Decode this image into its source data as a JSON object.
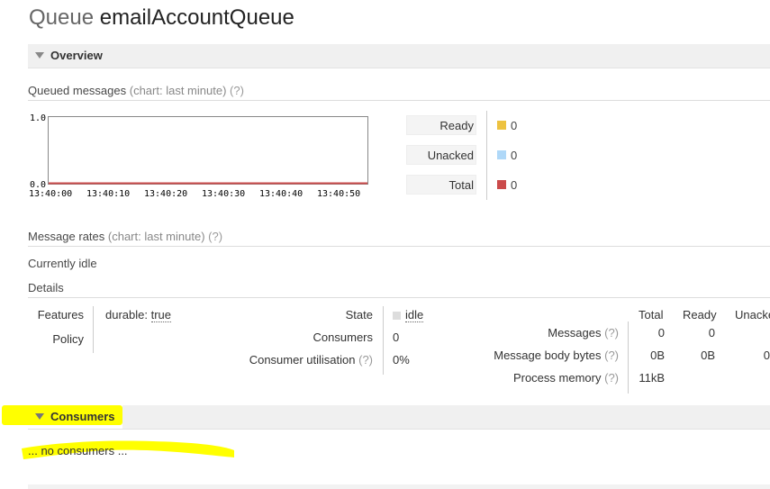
{
  "header": {
    "label": "Queue",
    "name": "emailAccountQueue"
  },
  "overview": {
    "title": "Overview",
    "queued_messages": {
      "title": "Queued messages",
      "chart_note": "(chart: last minute)",
      "help": "(?)"
    },
    "legend": [
      {
        "label": "Ready",
        "value": "0",
        "color": "#edc240"
      },
      {
        "label": "Unacked",
        "value": "0",
        "color": "#afd8f8"
      },
      {
        "label": "Total",
        "value": "0",
        "color": "#cb4b4b"
      }
    ],
    "message_rates": {
      "title": "Message rates",
      "chart_note": "(chart: last minute)",
      "help": "(?)"
    },
    "idle_text": "Currently idle",
    "details_title": "Details",
    "features": {
      "label": "Features",
      "key": "durable:",
      "value": "true"
    },
    "policy": {
      "label": "Policy"
    },
    "state": {
      "label": "State",
      "value": "idle"
    },
    "consumers": {
      "label": "Consumers",
      "value": "0"
    },
    "consumer_utilisation": {
      "label": "Consumer utilisation",
      "help": "(?)",
      "value": "0%"
    },
    "stats_headers": [
      "Total",
      "Ready",
      "Unacke"
    ],
    "messages": {
      "label": "Messages",
      "help": "(?)",
      "total": "0",
      "ready": "0"
    },
    "body_bytes": {
      "label": "Message body bytes",
      "help": "(?)",
      "total": "0B",
      "ready": "0B",
      "unacked": "0"
    },
    "process_memory": {
      "label": "Process memory",
      "help": "(?)",
      "total": "11kB"
    }
  },
  "consumers_section": {
    "title": "Consumers",
    "empty_text": "... no consumers ..."
  },
  "chart_data": {
    "type": "line",
    "x": [
      "13:40:00",
      "13:40:10",
      "13:40:20",
      "13:40:30",
      "13:40:40",
      "13:40:50"
    ],
    "series": [
      {
        "name": "Ready",
        "values": [
          0,
          0,
          0,
          0,
          0,
          0
        ]
      },
      {
        "name": "Unacked",
        "values": [
          0,
          0,
          0,
          0,
          0,
          0
        ]
      },
      {
        "name": "Total",
        "values": [
          0,
          0,
          0,
          0,
          0,
          0
        ]
      }
    ],
    "ylim": [
      0,
      1
    ],
    "yticks": [
      "1.0",
      "0.0"
    ],
    "title": "",
    "xlabel": "",
    "ylabel": ""
  }
}
